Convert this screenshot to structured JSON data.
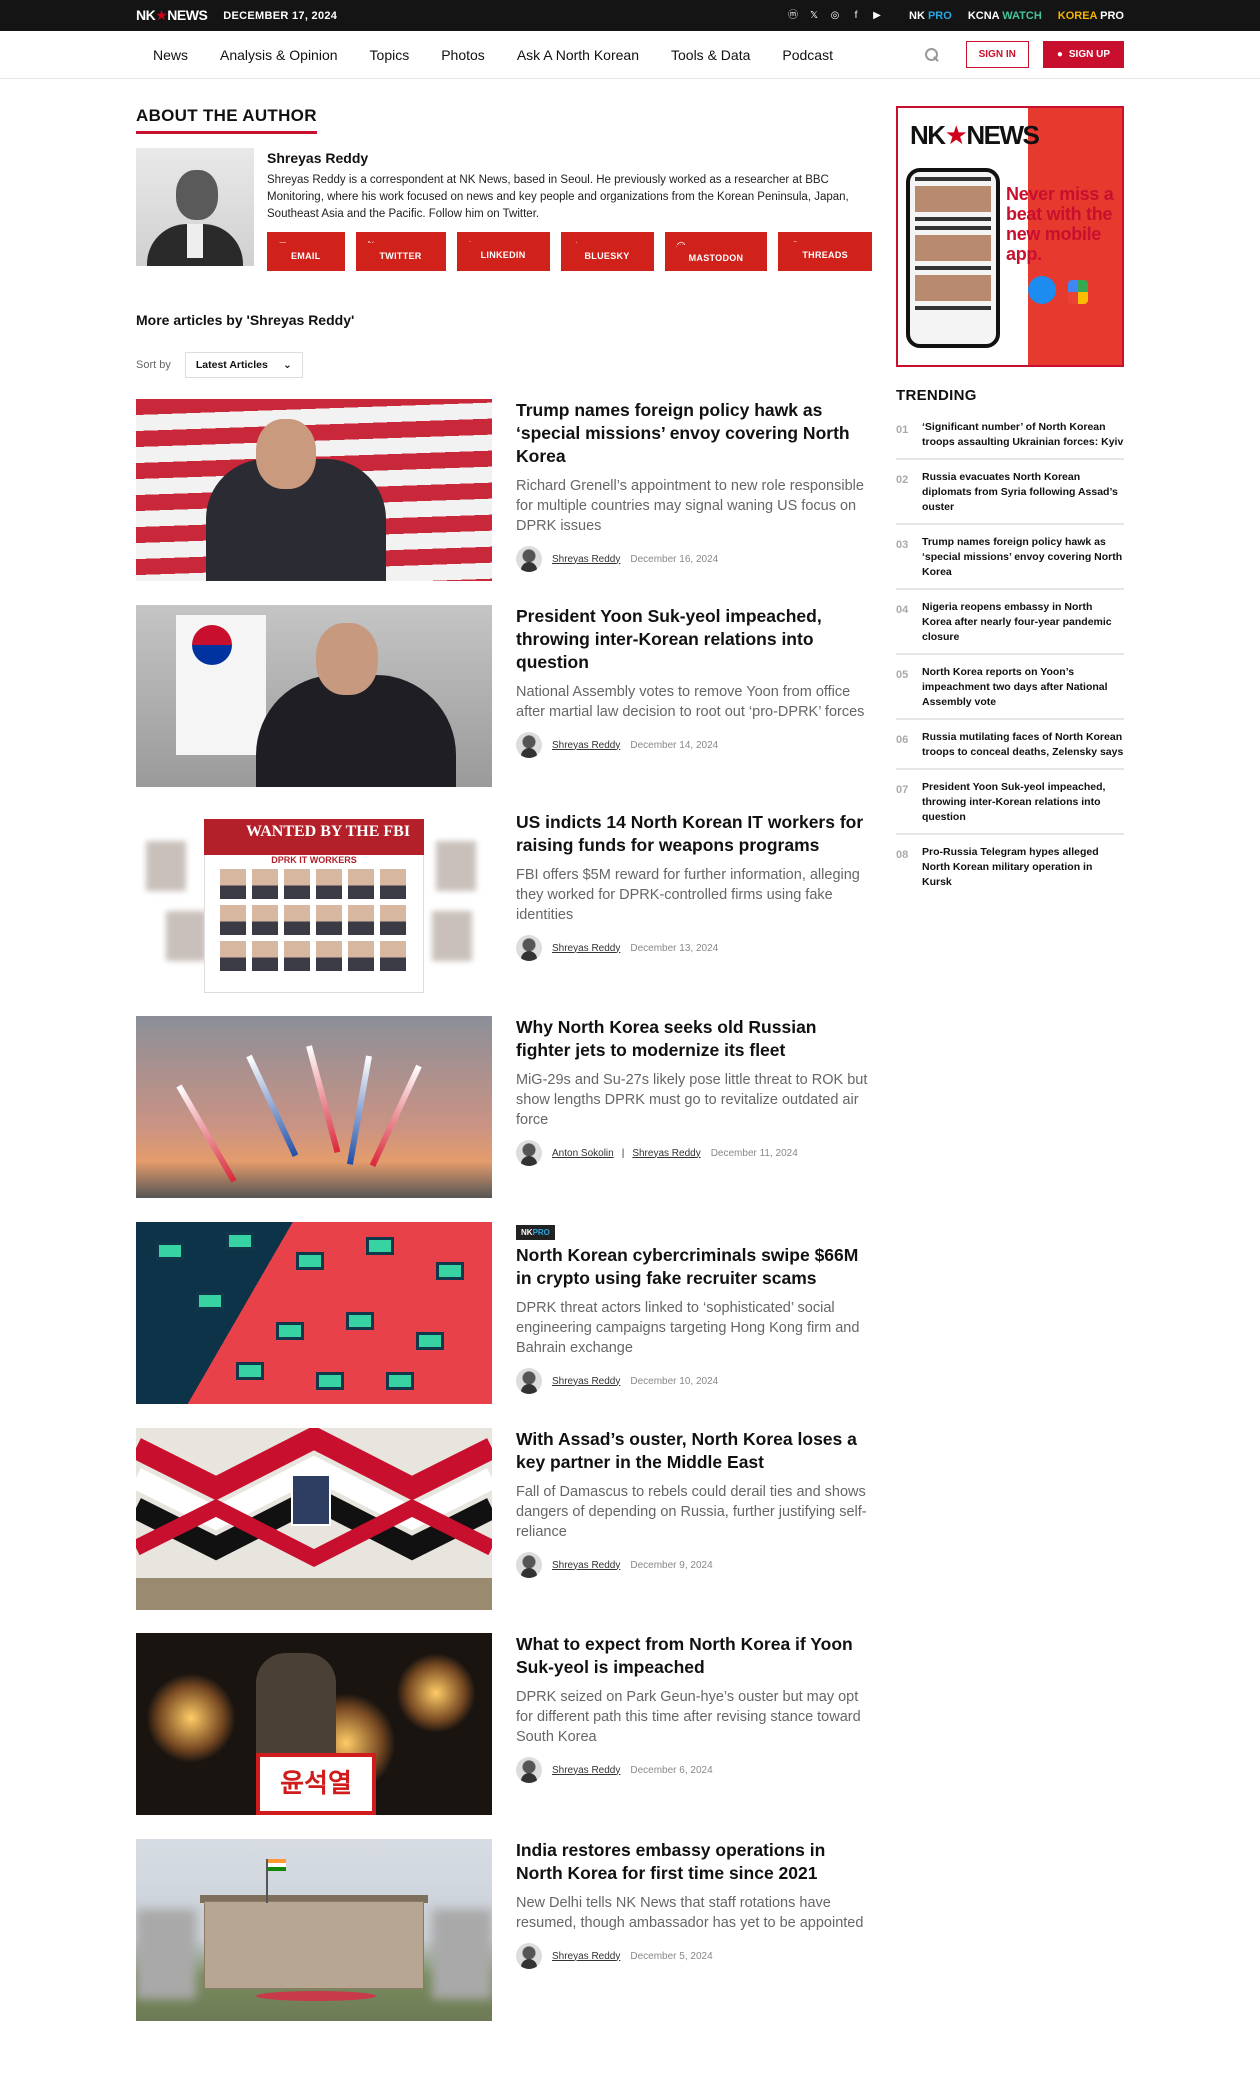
{
  "topbar": {
    "logo": "NK",
    "logo_b": "NEWS",
    "date": "DECEMBER 17, 2024",
    "socials": [
      "mastodon-icon",
      "x-icon",
      "instagram-icon",
      "facebook-icon",
      "youtube-icon"
    ],
    "products": [
      {
        "a": "NK",
        "b": "PRO"
      },
      {
        "a": "KCNA",
        "b": "WATCH"
      },
      {
        "a": "KOREA",
        "b": "PRO"
      }
    ]
  },
  "nav": {
    "items": [
      "News",
      "Analysis & Opinion",
      "Topics",
      "Photos",
      "Ask A North Korean",
      "Tools & Data",
      "Podcast"
    ],
    "signin": "SIGN IN",
    "signup": "SIGN UP"
  },
  "author": {
    "section_title": "ABOUT THE AUTHOR",
    "name": "Shreyas Reddy",
    "bio": "Shreyas Reddy is a correspondent at NK News, based in Seoul. He previously worked as a researcher at BBC Monitoring, where his work focused on news and key people and organizations from the Korean Peninsula, Japan, Southeast Asia and the Pacific. Follow him on Twitter.",
    "links": [
      "EMAIL",
      "TWITTER",
      "LINKEDIN",
      "BLUESKY",
      "MASTODON",
      "THREADS"
    ]
  },
  "more": {
    "title": "More articles by 'Shreyas Reddy'",
    "sort_label": "Sort by",
    "sort_value": "Latest Articles"
  },
  "articles": [
    {
      "title": "Trump names foreign policy hawk as ‘special missions’ envoy covering North Korea",
      "summary": "Richard Grenell’s appointment to new role responsible for multiple countries may signal waning US focus on DPRK issues",
      "author": "Shreyas Reddy",
      "date": "December 16, 2024"
    },
    {
      "title": "President Yoon Suk-yeol impeached, throwing inter-Korean relations into question",
      "summary": "National Assembly votes to remove Yoon from office after martial law decision to root out ‘pro-DPRK’ forces",
      "author": "Shreyas Reddy",
      "date": "December 14, 2024"
    },
    {
      "title": "US indicts 14 North Korean IT workers for raising funds for weapons programs",
      "summary": "FBI offers $5M reward for further information, alleging they worked for DPRK-controlled firms using fake identities",
      "author": "Shreyas Reddy",
      "date": "December 13, 2024",
      "thumb_banner": "WANTED BY THE FBI",
      "thumb_sub": "DPRK IT WORKERS"
    },
    {
      "title": "Why North Korea seeks old Russian fighter jets to modernize its fleet",
      "summary": "MiG-29s and Su-27s likely pose little threat to ROK but show lengths DPRK must go to revitalize outdated air force",
      "author": "Anton Sokolin",
      "coauthor": "Shreyas Reddy",
      "date": "December 11, 2024"
    },
    {
      "badge_a": "NK",
      "badge_b": "PRO",
      "title": "North Korean cybercriminals swipe $66M in crypto using fake recruiter scams",
      "summary": "DPRK threat actors linked to ‘sophisticated’ social engineering campaigns targeting Hong Kong firm and Bahrain exchange",
      "author": "Shreyas Reddy",
      "date": "December 10, 2024"
    },
    {
      "title": "With Assad’s ouster, North Korea loses a key partner in the Middle East",
      "summary": "Fall of Damascus to rebels could derail ties and shows dangers of depending on Russia, further justifying self-reliance",
      "author": "Shreyas Reddy",
      "date": "December 9, 2024"
    },
    {
      "title": "What to expect from North Korea if Yoon Suk-yeol is impeached",
      "summary": "DPRK seized on Park Geun-hye’s ouster but may opt for different path this time after revising stance toward South Korea",
      "author": "Shreyas Reddy",
      "date": "December 6, 2024",
      "thumb_sign": "윤석열"
    },
    {
      "title": "India restores embassy operations in North Korea for first time since 2021",
      "summary": "New Delhi tells NK News that staff rotations have resumed, though ambassador has yet to be appointed",
      "author": "Shreyas Reddy",
      "date": "December 5, 2024"
    }
  ],
  "sidebar": {
    "ad_logo_a": "NK",
    "ad_logo_b": "NEWS",
    "ad_text": "Never miss a beat with the new mobile app.",
    "trending_title": "TRENDING",
    "trending": [
      {
        "num": "01",
        "text": "‘Significant number’ of North Korean troops assaulting Ukrainian forces: Kyiv"
      },
      {
        "num": "02",
        "text": "Russia evacuates North Korean diplomats from Syria following Assad’s ouster"
      },
      {
        "num": "03",
        "text": "Trump names foreign policy hawk as ‘special missions’ envoy covering North Korea"
      },
      {
        "num": "04",
        "text": "Nigeria reopens embassy in North Korea after nearly four-year pandemic closure"
      },
      {
        "num": "05",
        "text": "North Korea reports on Yoon’s impeachment two days after National Assembly vote"
      },
      {
        "num": "06",
        "text": "Russia mutilating faces of North Korean troops to conceal deaths, Zelensky says"
      },
      {
        "num": "07",
        "text": "President Yoon Suk-yeol impeached, throwing inter-Korean relations into question"
      },
      {
        "num": "08",
        "text": "Pro-Russia Telegram hypes alleged North Korean military operation in Kursk"
      }
    ]
  },
  "colors": {
    "brand_red": "#c8102e",
    "nk_pro_blue": "#29a8e0",
    "kcna_green": "#43c59e",
    "korea_pro_yellow": "#f5b400"
  }
}
